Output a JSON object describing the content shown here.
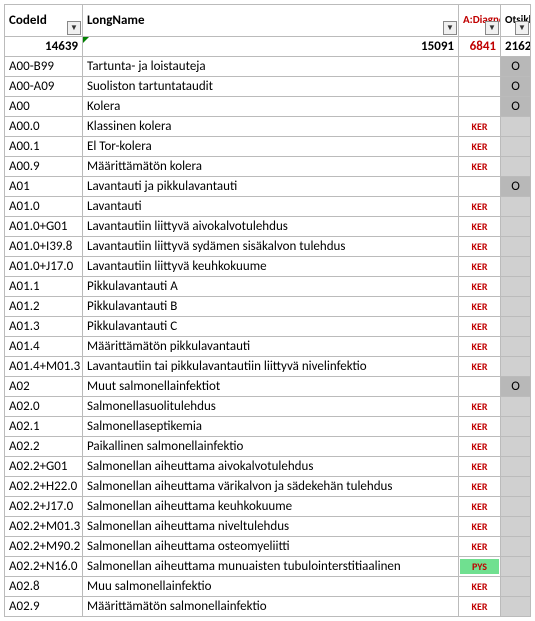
{
  "headers": {
    "codeid": "CodeId",
    "longname": "LongName",
    "diag": "A:Diagnoo",
    "otsi": "Otsikk"
  },
  "totals": {
    "codeid": "14639",
    "longname": "15091",
    "diag": "6841",
    "otsi": "2162"
  },
  "rows": [
    {
      "code": "A00-B99",
      "name": "Tartunta- ja loistauteja",
      "tag": "",
      "o": "O"
    },
    {
      "code": "A00-A09",
      "name": "Suoliston tartuntataudit",
      "tag": "",
      "o": "O"
    },
    {
      "code": "A00",
      "name": "Kolera",
      "tag": "",
      "o": "O"
    },
    {
      "code": "A00.0",
      "name": "Klassinen kolera",
      "tag": "KER",
      "o": ""
    },
    {
      "code": "A00.1",
      "name": "El Tor-kolera",
      "tag": "KER",
      "o": ""
    },
    {
      "code": "A00.9",
      "name": "Määrittämätön kolera",
      "tag": "KER",
      "o": ""
    },
    {
      "code": "A01",
      "name": "Lavantauti ja pikkulavantauti",
      "tag": "",
      "o": "O"
    },
    {
      "code": "A01.0",
      "name": "Lavantauti",
      "tag": "KER",
      "o": ""
    },
    {
      "code": "A01.0+G01",
      "name": "Lavantautiin liittyvä aivokalvotulehdus",
      "tag": "KER",
      "o": ""
    },
    {
      "code": "A01.0+I39.8",
      "name": "Lavantautiin liittyvä sydämen sisäkalvon tulehdus",
      "tag": "KER",
      "o": ""
    },
    {
      "code": "A01.0+J17.0",
      "name": "Lavantautiin liittyvä keuhkokuume",
      "tag": "KER",
      "o": ""
    },
    {
      "code": "A01.1",
      "name": "Pikkulavantauti A",
      "tag": "KER",
      "o": ""
    },
    {
      "code": "A01.2",
      "name": "Pikkulavantauti B",
      "tag": "KER",
      "o": ""
    },
    {
      "code": "A01.3",
      "name": "Pikkulavantauti C",
      "tag": "KER",
      "o": ""
    },
    {
      "code": "A01.4",
      "name": "Määrittämätön pikkulavantauti",
      "tag": "KER",
      "o": ""
    },
    {
      "code": "A01.4+M01.3",
      "name": "Lavantautiin tai pikkulavantautiin liittyvä nivelinfektio",
      "tag": "KER",
      "o": ""
    },
    {
      "code": "A02",
      "name": "Muut salmonellainfektiot",
      "tag": "",
      "o": "O"
    },
    {
      "code": "A02.0",
      "name": "Salmonellasuolitulehdus",
      "tag": "KER",
      "o": ""
    },
    {
      "code": "A02.1",
      "name": "Salmonellaseptikemia",
      "tag": "KER",
      "o": ""
    },
    {
      "code": "A02.2",
      "name": "Paikallinen salmonellainfektio",
      "tag": "KER",
      "o": ""
    },
    {
      "code": "A02.2+G01",
      "name": "Salmonellan aiheuttama aivokalvotulehdus",
      "tag": "KER",
      "o": ""
    },
    {
      "code": "A02.2+H22.0",
      "name": "Salmonellan aiheuttama värikalvon ja sädekehän tulehdus",
      "tag": "KER",
      "o": ""
    },
    {
      "code": "A02.2+J17.0",
      "name": "Salmonellan aiheuttama keuhkokuume",
      "tag": "KER",
      "o": ""
    },
    {
      "code": "A02.2+M01.3",
      "name": "Salmonellan aiheuttama niveltulehdus",
      "tag": "KER",
      "o": ""
    },
    {
      "code": "A02.2+M90.2",
      "name": "Salmonellan aiheuttama osteomyeliitti",
      "tag": "KER",
      "o": ""
    },
    {
      "code": "A02.2+N16.0",
      "name": "Salmonellan aiheuttama munuaisten tubulointerstitiaalinen",
      "tag": "PYS",
      "o": ""
    },
    {
      "code": "A02.8",
      "name": "Muu salmonellainfektio",
      "tag": "KER",
      "o": ""
    },
    {
      "code": "A02.9",
      "name": "Määrittämätön salmonellainfektio",
      "tag": "KER",
      "o": ""
    }
  ]
}
